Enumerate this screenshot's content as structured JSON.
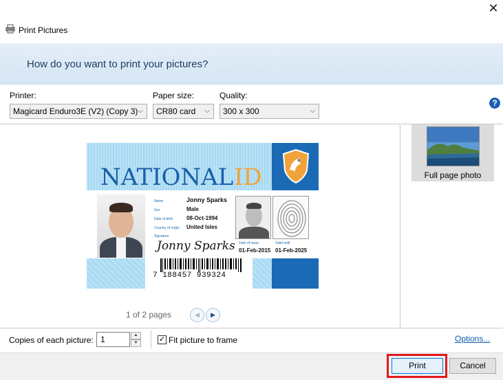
{
  "window": {
    "title": "Print Pictures",
    "close_glyph": "✕"
  },
  "header": {
    "question": "How do you want to print your pictures?"
  },
  "options": {
    "printer_label": "Printer:",
    "printer_value": "Magicard Enduro3E (V2) (Copy 3)",
    "paper_label": "Paper size:",
    "paper_value": "CR80 card",
    "quality_label": "Quality:",
    "quality_value": "300 x 300",
    "help_glyph": "?"
  },
  "card": {
    "title_word1": "NATIONAL",
    "title_word2": "ID",
    "fields": {
      "name_label": "Name",
      "name_value": "Jonny Sparks",
      "sex_label": "Sex",
      "sex_value": "Male",
      "dob_label": "Date of birth",
      "dob_value": "08-Oct-1994",
      "country_label": "Country of origin",
      "country_value": "United Isles",
      "signature_label": "Signature",
      "signature_value": "Jonny Sparks",
      "issue_label": "Date of issue",
      "issue_value": "01-Feb-2015",
      "valid_label": "Valid until",
      "valid_value": "01-Feb-2025"
    },
    "barcode_number": "7 188457 939324",
    "colors": {
      "blue": "#1b6ab5",
      "light_blue": "#b9e2f6",
      "orange": "#f0a33a"
    }
  },
  "preview": {
    "page_indicator": "1 of 2 pages",
    "prev_glyph": "◀",
    "next_glyph": "▶"
  },
  "layouts": {
    "items": [
      {
        "label": "Full page photo",
        "icon": "landscape-photo-thumbnail"
      }
    ]
  },
  "bottom": {
    "copies_label": "Copies of each picture:",
    "copies_value": "1",
    "spin_up_glyph": "▲",
    "spin_down_glyph": "▼",
    "fit_checked": true,
    "fit_check_glyph": "✓",
    "fit_label": "Fit picture to frame",
    "options_link": "Options..."
  },
  "footer": {
    "print_label": "Print",
    "cancel_label": "Cancel",
    "highlight_color": "#e0191d"
  }
}
